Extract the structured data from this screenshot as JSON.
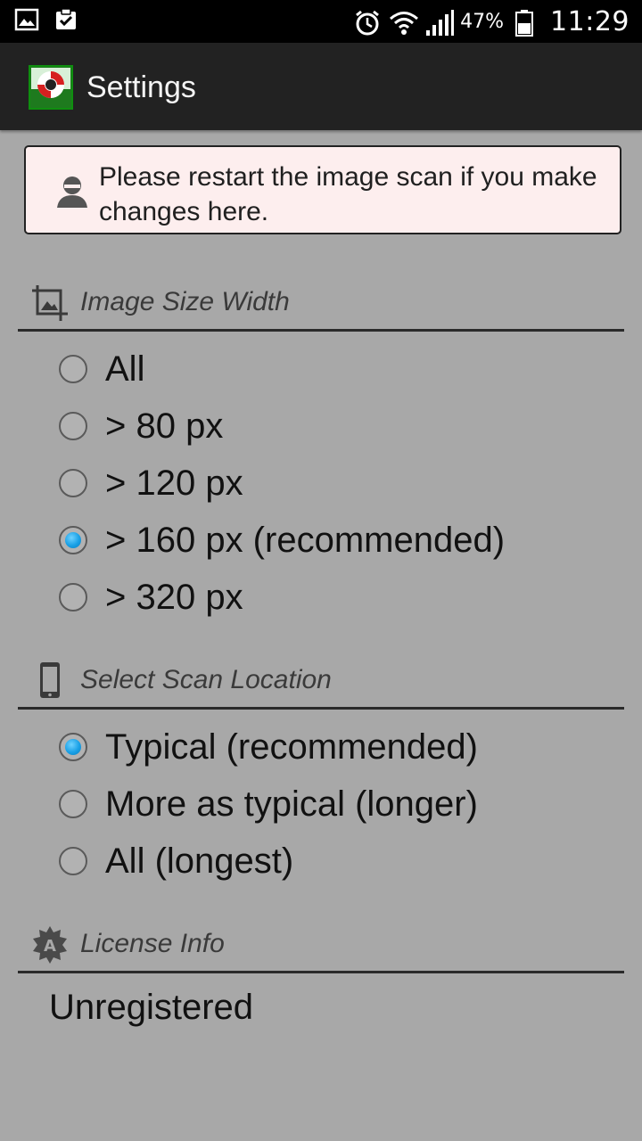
{
  "status_bar": {
    "left_icons": [
      "gallery-icon",
      "clipboard-check-icon"
    ],
    "right_icons": [
      "alarm-icon",
      "wifi-icon",
      "signal-icon",
      "battery-icon"
    ],
    "battery_percent": "47%",
    "time": "11:29"
  },
  "action_bar": {
    "title": "Settings",
    "icon": "lifebuoy-app-icon"
  },
  "notice": {
    "icon": "user-icon",
    "text": "Please restart the image scan if you make changes here.",
    "background": "#fdeeee"
  },
  "image_size": {
    "title": "Image Size Width",
    "icon": "crop-image-icon",
    "options": [
      {
        "label": "All",
        "checked": false
      },
      {
        "label": "> 80 px",
        "checked": false
      },
      {
        "label": "> 120 px",
        "checked": false
      },
      {
        "label": "> 160 px (recommended)",
        "checked": true
      },
      {
        "label": "> 320 px",
        "checked": false
      }
    ]
  },
  "scan_location": {
    "title": "Select Scan Location",
    "icon": "phone-icon",
    "options": [
      {
        "label": "Typical (recommended)",
        "checked": true
      },
      {
        "label": "More as typical (longer)",
        "checked": false
      },
      {
        "label": "All (longest)",
        "checked": false
      }
    ]
  },
  "license": {
    "title": "License Info",
    "icon": "badge-a-icon",
    "value": "Unregistered"
  },
  "colors": {
    "background": "#a8a8a8",
    "action_bar": "#222222",
    "radio_accent": "#19a0e6"
  }
}
